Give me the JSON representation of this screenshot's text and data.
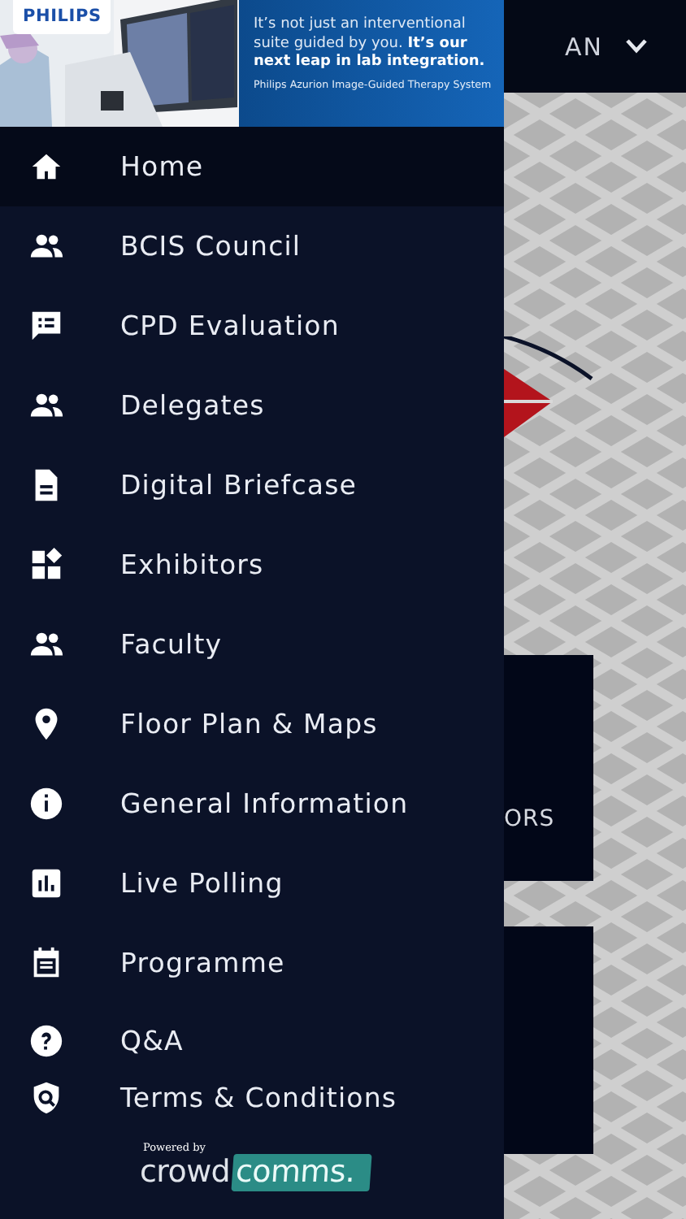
{
  "banner": {
    "brand": "PHILIPS",
    "headline": "It’s not just an interventional suite guided by you. **It’s our next leap in lab integration.**",
    "subline": "Philips Azurion Image-Guided Therapy System"
  },
  "header": {
    "initials": "AN"
  },
  "menu": [
    {
      "label": "Home",
      "kind": "home",
      "selected": true
    },
    {
      "label": "BCIS Council",
      "kind": "people",
      "selected": false
    },
    {
      "label": "CPD Evaluation",
      "kind": "feedback",
      "selected": false
    },
    {
      "label": "Delegates",
      "kind": "people",
      "selected": false
    },
    {
      "label": "Digital Briefcase",
      "kind": "document",
      "selected": false
    },
    {
      "label": "Exhibitors",
      "kind": "widgets",
      "selected": false
    },
    {
      "label": "Faculty",
      "kind": "people",
      "selected": false
    },
    {
      "label": "Floor Plan & Maps",
      "kind": "pin",
      "selected": false
    },
    {
      "label": "General Information",
      "kind": "info",
      "selected": false
    },
    {
      "label": "Live Polling",
      "kind": "chart",
      "selected": false
    },
    {
      "label": "Programme",
      "kind": "calendar",
      "selected": false
    },
    {
      "label": "Q&A",
      "kind": "question",
      "selected": false
    },
    {
      "label": "Terms & Conditions",
      "kind": "shield",
      "selected": false
    }
  ],
  "footer": {
    "powered_by": "Powered by",
    "logo_left": "crowd",
    "logo_right": "comms",
    "logo_dot": "."
  },
  "background": {
    "card_text": "ORS"
  }
}
